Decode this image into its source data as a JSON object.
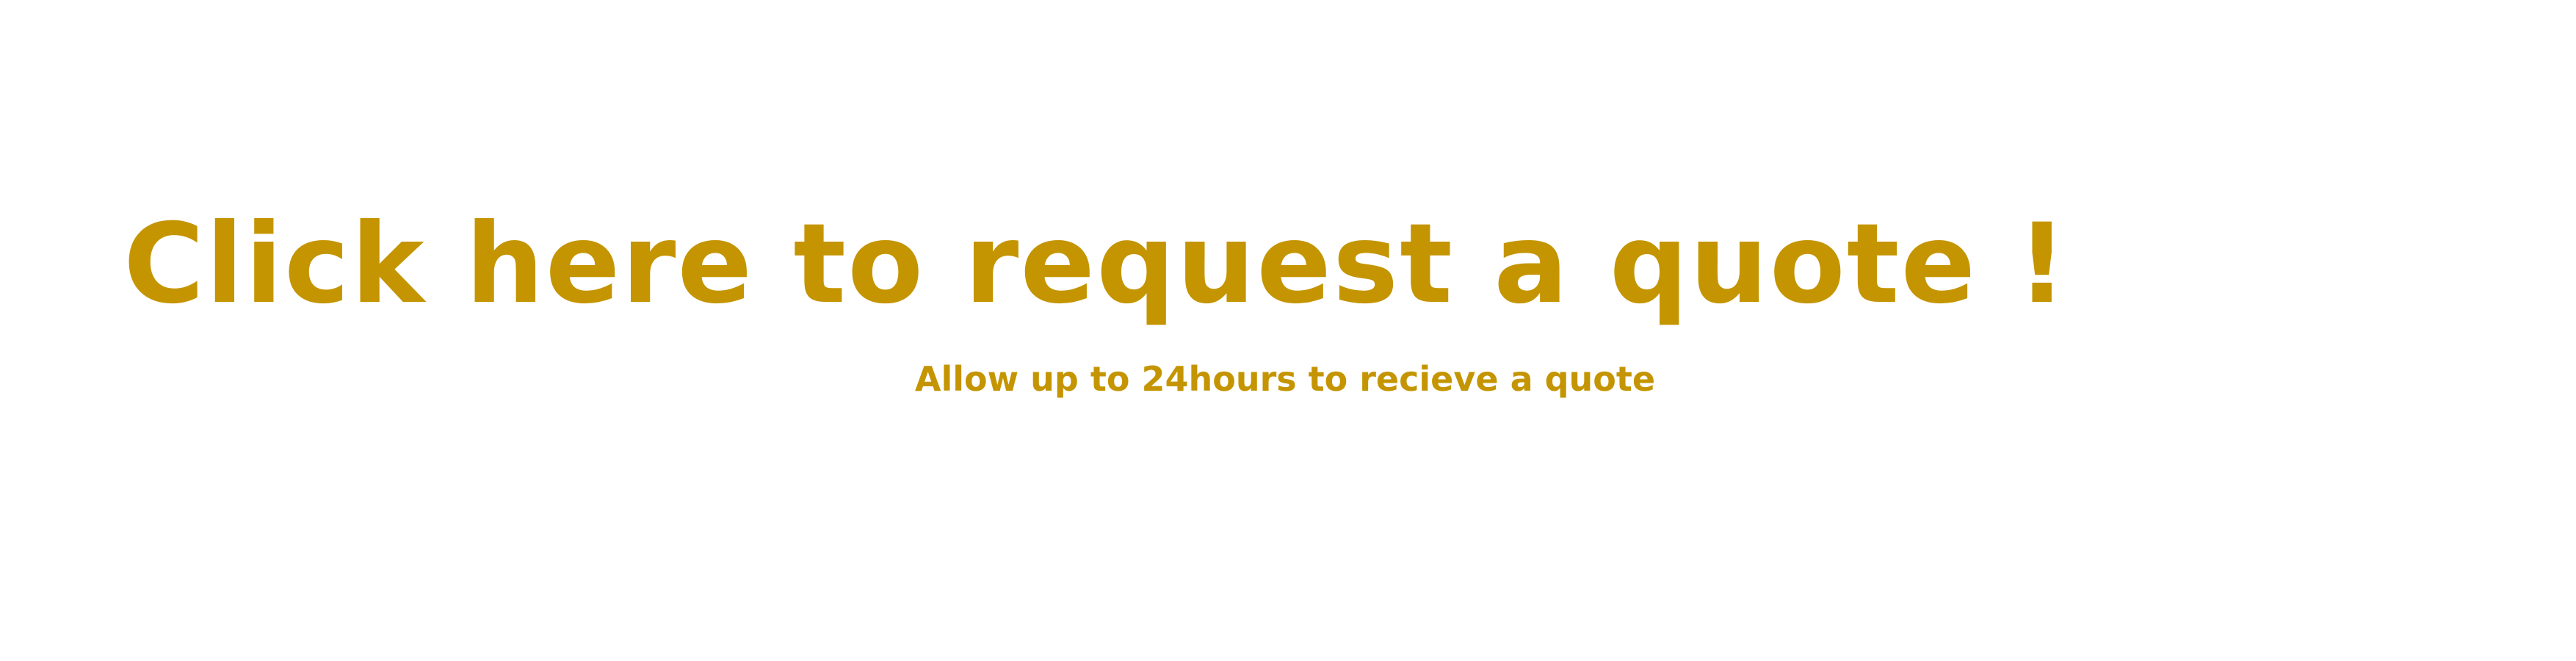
{
  "cta": {
    "title": "Click here to request a quote !",
    "subtitle": "Allow up to 24hours to recieve a quote"
  },
  "colors": {
    "accent": "#c49500",
    "background": "#ffffff"
  }
}
